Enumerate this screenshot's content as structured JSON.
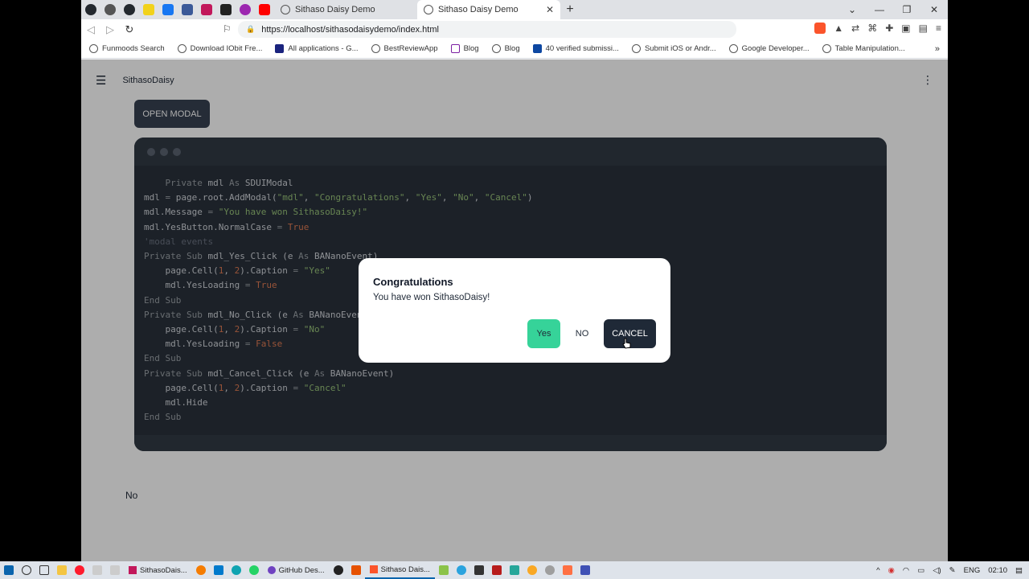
{
  "browser": {
    "tabs": [
      {
        "title": "Sithaso Daisy Demo",
        "active": false
      },
      {
        "title": "Sithaso Daisy Demo",
        "active": true
      }
    ],
    "url": "https://localhost/sithasodaisydemo/index.html",
    "bookmarks": [
      "Funmoods Search",
      "Download IObit Fre...",
      "All applications - G...",
      "BestReviewApp",
      "Blog",
      "Blog",
      "40 verified submissi...",
      "Submit iOS or Andr...",
      "Google Developer...",
      "Table Manipulation..."
    ]
  },
  "app": {
    "title": "SithasoDaisy",
    "open_modal_label": "OPEN MODAL",
    "result_text": "No"
  },
  "code": {
    "lines": [
      "    Private mdl As SDUIModal",
      "mdl = page.root.AddModal(\"mdl\", \"Congratulations\", \"Yes\", \"No\", \"Cancel\")",
      "mdl.Message = \"You have won SithasoDaisy!\"",
      "mdl.YesButton.NormalCase = True",
      "'modal events",
      "Private Sub mdl_Yes_Click (e As BANanoEvent)",
      "    page.Cell(1, 2).Caption = \"Yes\"",
      "    mdl.YesLoading = True",
      "End Sub",
      "Private Sub mdl_No_Click (e As BANanoEvent)",
      "    page.Cell(1, 2).Caption = \"No\"",
      "    mdl.YesLoading = False",
      "End Sub",
      "Private Sub mdl_Cancel_Click (e As BANanoEvent)",
      "    page.Cell(1, 2).Caption = \"Cancel\"",
      "    mdl.Hide",
      "End Sub"
    ]
  },
  "modal": {
    "title": "Congratulations",
    "message": "You have won SithasoDaisy!",
    "yes_label": "Yes",
    "no_label": "NO",
    "cancel_label": "CANCEL"
  },
  "taskbar": {
    "apps": [
      {
        "label": "SithasoDais...",
        "active": false
      },
      {
        "label": "GitHub Des...",
        "active": false
      },
      {
        "label": "Sithaso Dais...",
        "active": true
      }
    ],
    "lang": "ENG",
    "time": "02:10"
  },
  "colors": {
    "yes": "#36d399",
    "cancel": "#1f2937",
    "code_bg": "#2a323c"
  }
}
